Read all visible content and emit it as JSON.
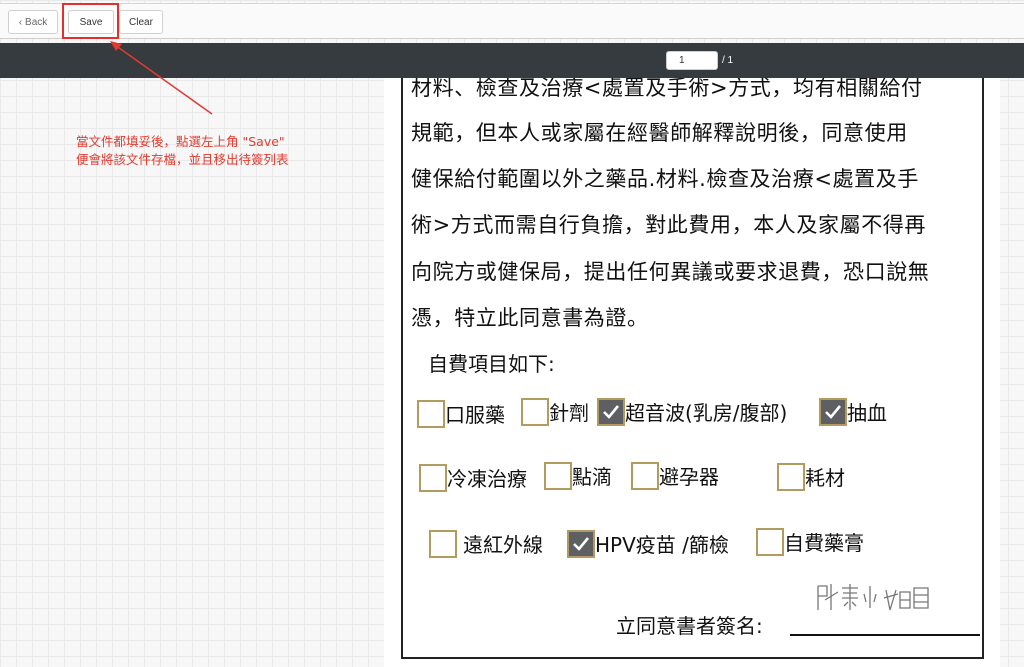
{
  "toolbar": {
    "back_label": "Back",
    "save_label": "Save",
    "clear_label": "Clear"
  },
  "pager": {
    "current_page": "1",
    "total_label": "/ 1"
  },
  "annotation": {
    "line1": "當文件都填妥後，點選左上角 \"Save\"",
    "line2": "便會將該文件存檔，並且移出待簽列表",
    "color": "#e23a2f"
  },
  "document": {
    "lines": [
      "材料、檢查及治療<處置及手術>方式，均有相關給付",
      "規範，但本人或家屬在經醫師解釋說明後，同意使用",
      "健保給付範圍以外之藥品.材料.檢查及治療<處置及手",
      "術>方式而需自行負擔，對此費用，本人及家屬不得再",
      "向院方或健保局，提出任何異議或要求退費，恐口說無",
      "憑，特立此同意書為證。"
    ],
    "section_title": "自費項目如下:",
    "options": [
      {
        "label": "口服藥",
        "checked": false
      },
      {
        "label": "針劑",
        "checked": false
      },
      {
        "label": "超音波(乳房/腹部)",
        "checked": true
      },
      {
        "label": "抽血",
        "checked": true
      },
      {
        "label": "冷凍治療",
        "checked": false
      },
      {
        "label": "點滴",
        "checked": false
      },
      {
        "label": "避孕器",
        "checked": false
      },
      {
        "label": "耗材",
        "checked": false
      },
      {
        "label": "遠紅外線",
        "checked": false
      },
      {
        "label": "HPV疫苗 /篩檢",
        "checked": true
      },
      {
        "label": "自費藥膏",
        "checked": false
      }
    ],
    "signature_label": "立同意書者簽名:",
    "signature_value": "陳小姐"
  }
}
